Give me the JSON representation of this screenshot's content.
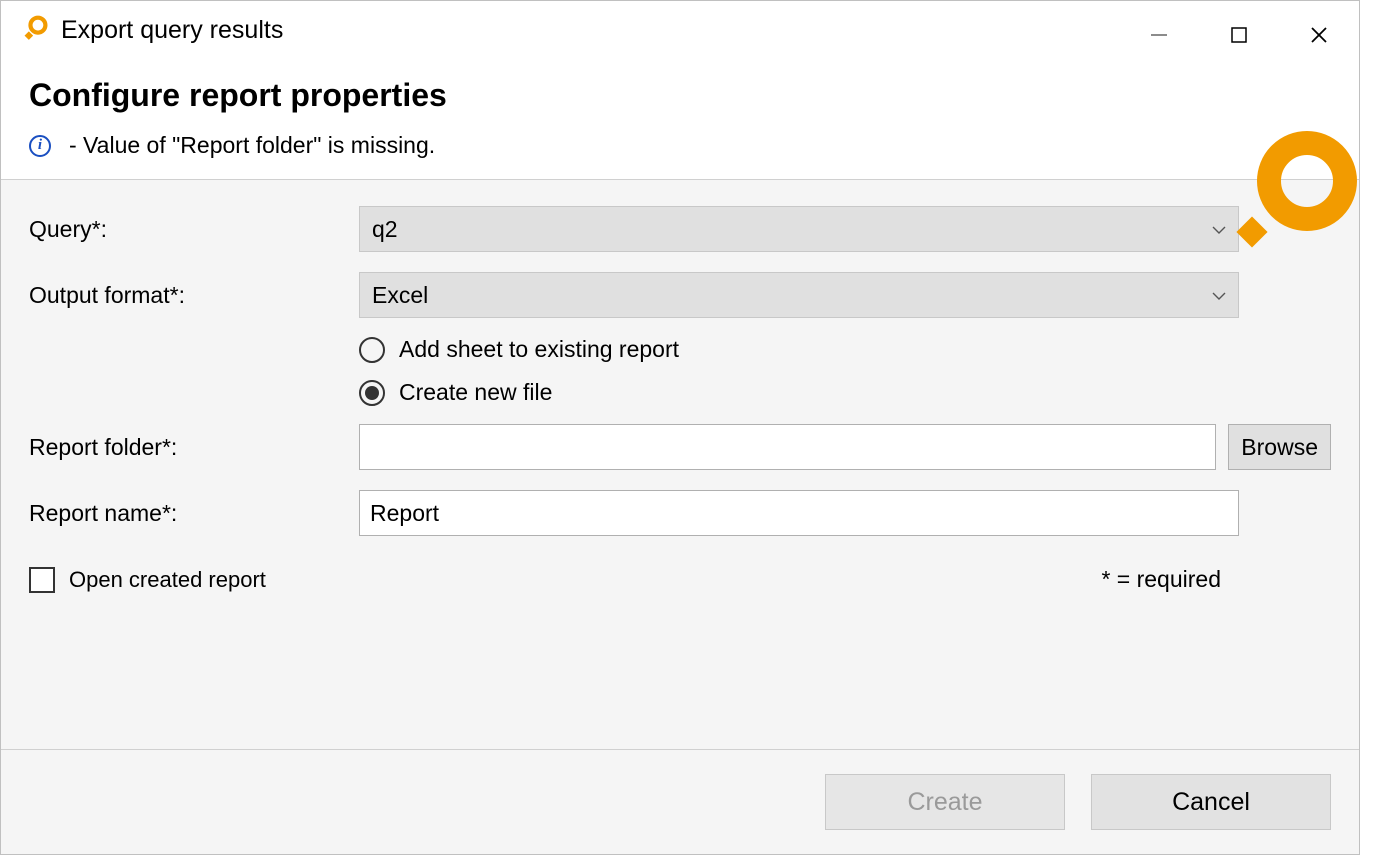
{
  "window": {
    "title": "Export query results"
  },
  "header": {
    "heading": "Configure report properties",
    "info_message": "- Value of \"Report folder\" is missing."
  },
  "form": {
    "query": {
      "label": "Query*:",
      "value": "q2"
    },
    "output_format": {
      "label": "Output format*:",
      "value": "Excel"
    },
    "radio": {
      "option_add": "Add sheet to existing report",
      "option_new": "Create new file",
      "selected": "new"
    },
    "report_folder": {
      "label": "Report folder*:",
      "value": "",
      "browse_label": "Browse"
    },
    "report_name": {
      "label": "Report name*:",
      "value": "Report"
    },
    "open_created": {
      "label": "Open created report",
      "checked": false
    },
    "required_note": "* = required"
  },
  "footer": {
    "create_label": "Create",
    "cancel_label": "Cancel",
    "create_enabled": false
  },
  "colors": {
    "accent": "#f29b00"
  }
}
